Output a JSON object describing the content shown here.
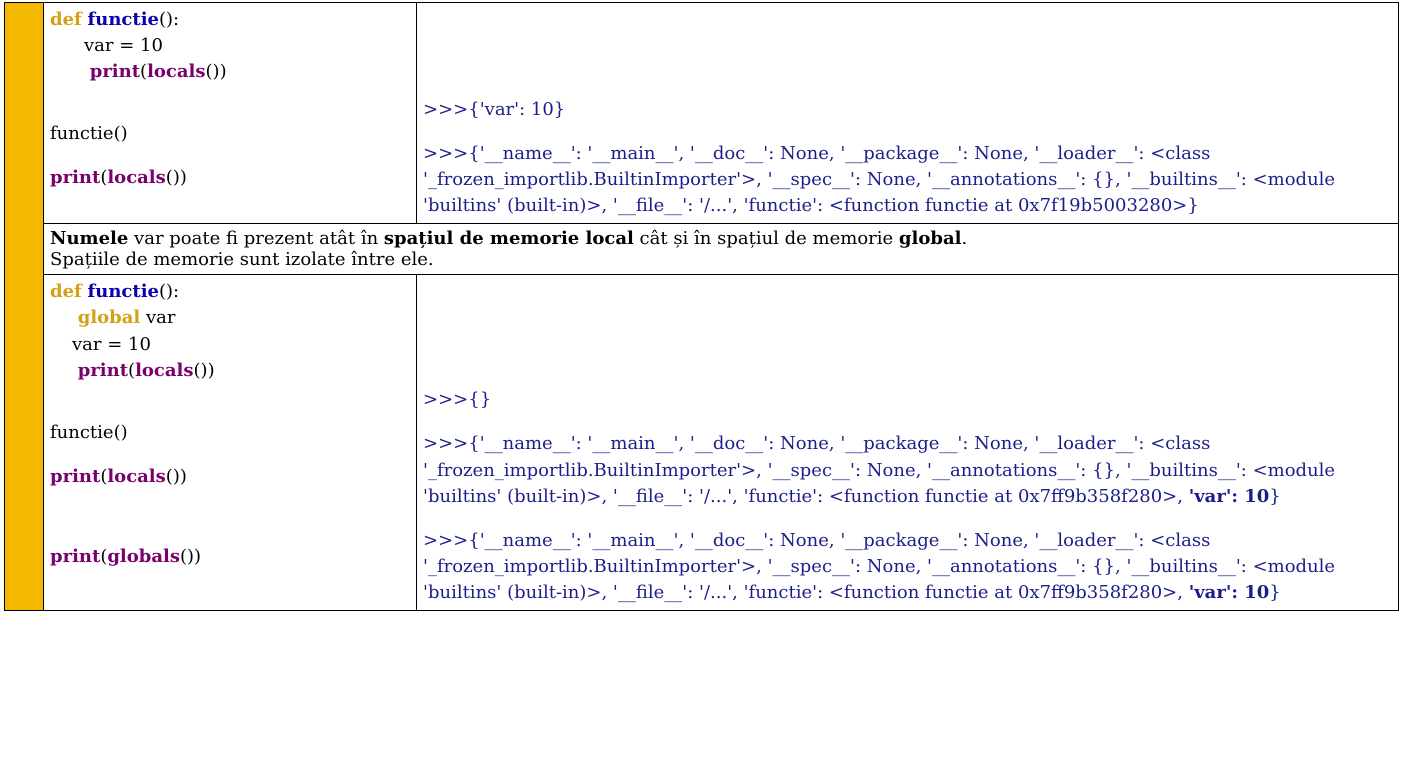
{
  "colors": {
    "stripe": "#f5b800",
    "keyword": "#d4a017",
    "function_name": "#0b00b0",
    "builtin": "#7a006e",
    "output": "#1b1e8a"
  },
  "row1": {
    "code": {
      "line1": {
        "def": "def",
        "name": "functie",
        "tail": "():"
      },
      "line2": "var = 10",
      "line3": {
        "print": "print",
        "open": "(",
        "builtin": "locals",
        "tail": "())"
      },
      "call": "functie()",
      "line5": {
        "print": "print",
        "open": "(",
        "builtin": "locals",
        "tail": "())"
      }
    },
    "output": {
      "l1": ">>>{'var': 10}",
      "l2a": ">>>{'__name__': '__main__', '__doc__': None, '__package__': None, '__loader__': <class",
      "l2b": "'_frozen_importlib.BuiltinImporter'>, '__spec__': None, '__annotations__': {}, '__builtins__': <module",
      "l2c": "'builtins' (built-in)>, '__file__': '/...', 'functie': <function functie at 0x7f19b5003280>}"
    }
  },
  "note": {
    "b1": "Numele",
    "t1": " var poate fi prezent atât în ",
    "b2": "spațiul de memorie local",
    "t2": " cât și în spațiul de memorie ",
    "b3": "global",
    "t3": ".",
    "line2": "Spațiile de memorie sunt izolate între ele."
  },
  "row2": {
    "code": {
      "line1": {
        "def": "def",
        "name": "functie",
        "tail": "():"
      },
      "line2": {
        "global": "global",
        "var": " var"
      },
      "line3": "var = 10",
      "line4": {
        "print": "print",
        "open": "(",
        "builtin": "locals",
        "tail": "())"
      },
      "call": "functie()",
      "line6": {
        "print": "print",
        "open": "(",
        "builtin": "locals",
        "tail": "())"
      },
      "line7": {
        "print": "print",
        "open": "(",
        "builtin": "globals",
        "tail": "())"
      }
    },
    "output": {
      "l1": ">>>{}",
      "l2a": ">>>{'__name__': '__main__', '__doc__': None, '__package__': None, '__loader__': <class",
      "l2b": "'_frozen_importlib.BuiltinImporter'>, '__spec__': None, '__annotations__': {}, '__builtins__': <module",
      "l2c": "'builtins' (built-in)>, '__file__': '/...', 'functie': <function functie at 0x7ff9b358f280>, ",
      "l2d_bold": "'var': 10",
      "l2d_tail": "}",
      "l3a": ">>>{'__name__': '__main__', '__doc__': None, '__package__': None, '__loader__': <class",
      "l3b": "'_frozen_importlib.BuiltinImporter'>, '__spec__': None, '__annotations__': {}, '__builtins__': <module",
      "l3c": "'builtins' (built-in)>, '__file__': '/...', 'functie': <function functie at 0x7ff9b358f280>, ",
      "l3d_bold": "'var': 10",
      "l3d_tail": "}"
    }
  }
}
